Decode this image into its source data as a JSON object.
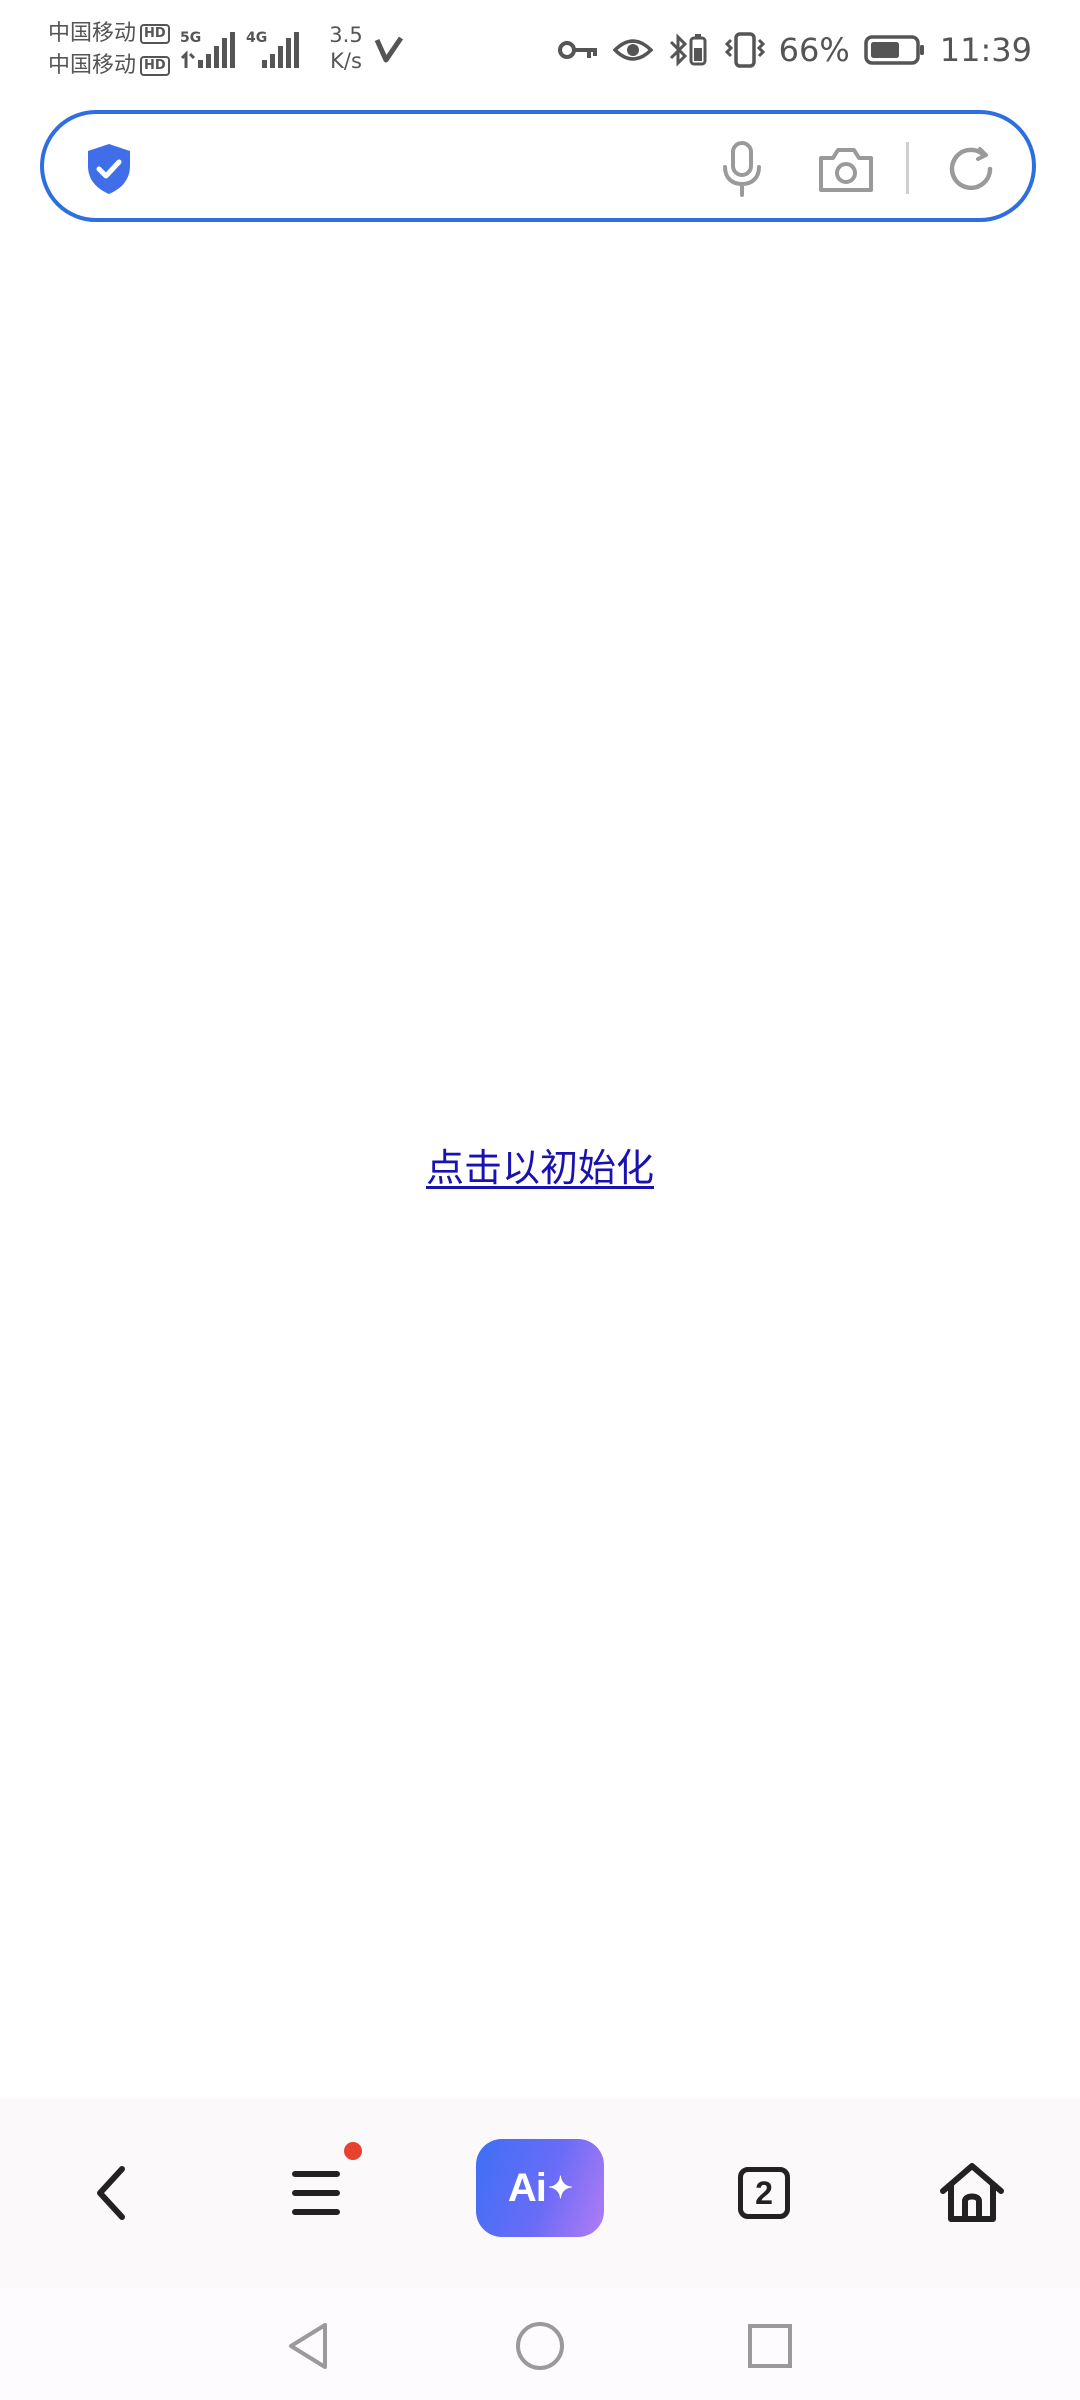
{
  "status_bar": {
    "carrier_1": "中国移动",
    "carrier_2": "中国移动",
    "hd_badge": "HD",
    "network_1": "5G",
    "network_2": "4G",
    "speed_value": "3.5",
    "speed_unit": "K/s",
    "battery_percent": "66%",
    "battery_level": 0.66,
    "time": "11:39",
    "icons": [
      "v-app-icon",
      "key-icon",
      "eye-icon",
      "bluetooth-battery-icon",
      "vibrate-icon",
      "battery-icon"
    ]
  },
  "search_bar": {
    "query": "",
    "placeholder": "",
    "accent_color": "#2d6fe0",
    "icons": [
      "shield-check-icon",
      "mic-icon",
      "camera-icon",
      "refresh-icon"
    ]
  },
  "content": {
    "init_link_label": "点击以初始化",
    "link_color": "#1a12b0"
  },
  "toolbar": {
    "ai_label": "Ai",
    "ai_spark": "✦",
    "tab_count": "2",
    "has_notification": true,
    "notification_color": "#e8412f",
    "icons": [
      "back-icon",
      "menu-icon",
      "ai-assistant-icon",
      "tabs-icon",
      "home-icon"
    ]
  },
  "nav_bar": {
    "icons": [
      "nav-back-icon",
      "nav-home-icon",
      "nav-recents-icon"
    ]
  }
}
